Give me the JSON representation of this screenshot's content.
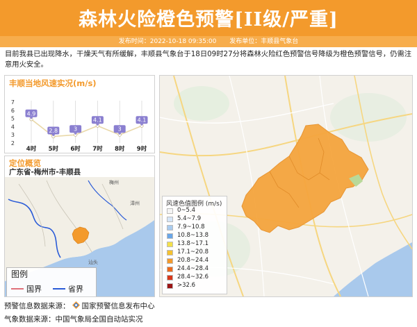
{
  "header": {
    "title": "森林火险橙色预警[II级/严重]"
  },
  "meta": {
    "publish_time": "发布时间：2022-10-18 09:35:00",
    "publisher": "发布单位：丰顺县气象台"
  },
  "description": "目前我县已出现降水，干燥天气有所缓解，丰顺县气象台于18日09时27分将森林火险红色预警信号降级为橙色预警信号，仍需注意用火安全。",
  "wind_panel": {
    "title": "丰顺当地风速实况(m/s)"
  },
  "location_panel": {
    "title": "定位概览",
    "region": "广东省-梅州市-丰顺县",
    "legend_title": "图例",
    "legend_items": [
      {
        "label": "国界",
        "color": "#e0707a"
      },
      {
        "label": "省界",
        "color": "#2a5bd7"
      }
    ],
    "map_labels": {
      "city1": "梅州",
      "city2": "汕头",
      "city3": "漳州"
    }
  },
  "map_legend": {
    "title": "风速色值图例 (m/s)",
    "items": [
      {
        "label": "0~5.4",
        "color": "#f5f5f5"
      },
      {
        "label": "5.4~7.9",
        "color": "#d6e6f8"
      },
      {
        "label": "7.9~10.8",
        "color": "#a9cbef"
      },
      {
        "label": "10.8~13.8",
        "color": "#6aa6e8"
      },
      {
        "label": "13.8~17.1",
        "color": "#f4e04a"
      },
      {
        "label": "17.1~20.8",
        "color": "#f5c230"
      },
      {
        "label": "20.8~24.4",
        "color": "#f39a2c"
      },
      {
        "label": "24.4~28.4",
        "color": "#ec6a1c"
      },
      {
        "label": "28.4~32.6",
        "color": "#d8381a"
      },
      {
        "label": ">32.6",
        "color": "#9b1515"
      }
    ]
  },
  "footer": {
    "warning_source": "预警信息数据来源：",
    "warning_source_name": "国家预警信息发布中心",
    "weather_source": "气象数据来源：中国气象局全国自动站实况"
  },
  "chart_data": {
    "type": "line",
    "categories": [
      "4时",
      "5时",
      "6时",
      "7时",
      "8时",
      "9时"
    ],
    "values": [
      4.9,
      2.8,
      3,
      4.1,
      3,
      4.1
    ],
    "title": "丰顺当地风速实况(m/s)",
    "ylim": [
      2,
      7
    ],
    "yticks": [
      2,
      3,
      4,
      5,
      6,
      7
    ],
    "grid": "vertical",
    "colors": {
      "line": "#e9d8a8",
      "point": "#ffffff",
      "label_bg": "#8a7fd0"
    }
  }
}
